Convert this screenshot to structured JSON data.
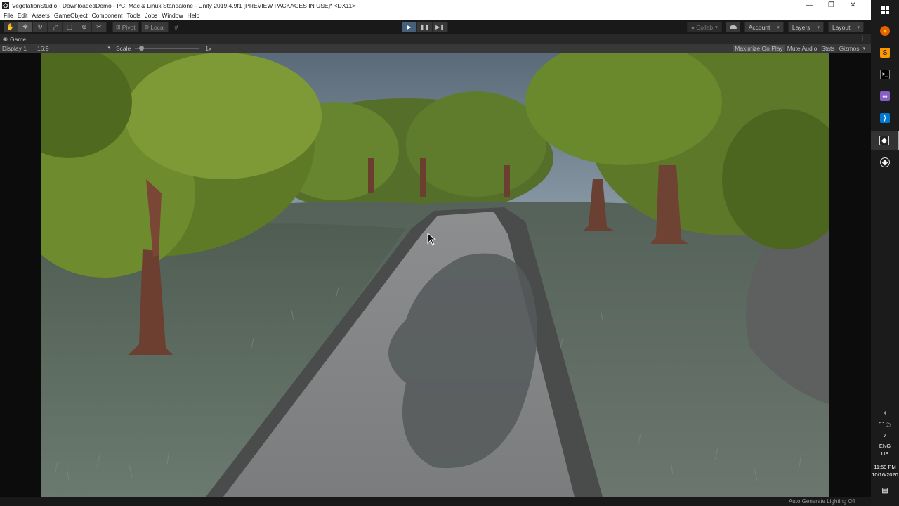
{
  "window": {
    "title": "VegetationStudio - DownloadedDemo - PC, Mac & Linux Standalone - Unity 2019.4.9f1 [PREVIEW PACKAGES IN USE]* <DX11>",
    "controls": [
      "—",
      "❐",
      "✕"
    ]
  },
  "menu": [
    "File",
    "Edit",
    "Assets",
    "GameObject",
    "Component",
    "Tools",
    "Jobs",
    "Window",
    "Help"
  ],
  "toolbar": {
    "tools": [
      {
        "name": "hand-tool",
        "glyph": "✋"
      },
      {
        "name": "move-tool",
        "glyph": "✥"
      },
      {
        "name": "rotate-tool",
        "glyph": "↻"
      },
      {
        "name": "scale-tool",
        "glyph": "⤢"
      },
      {
        "name": "rect-tool",
        "glyph": "▢"
      },
      {
        "name": "transform-tool",
        "glyph": "⊕"
      },
      {
        "name": "custom-tool",
        "glyph": "✂"
      }
    ],
    "active_tool": "move-tool",
    "pivot_label": "Pivot",
    "local_label": "Local",
    "collab_label": "Collab",
    "account_label": "Account",
    "layers_label": "Layers",
    "layout_label": "Layout"
  },
  "playback": {
    "play": "▶",
    "pause": "❚❚",
    "step": "▶❚",
    "playing": true
  },
  "game": {
    "tab_label": "Game",
    "display": "Display 1",
    "aspect": "16:9",
    "scale_label": "Scale",
    "scale_value": "1x",
    "options": [
      "Maximize On Play",
      "Mute Audio",
      "Stats",
      "Gizmos"
    ],
    "maximize_on_play_active": true
  },
  "status": {
    "message": "Auto Generate Lighting Off"
  },
  "taskbar": {
    "apps": [
      "start",
      "firefox",
      "sublime-text",
      "terminal",
      "visual-studio",
      "vscode",
      "unity",
      "unity-hub"
    ],
    "selected": "unity",
    "lang": "ENG",
    "region": "US",
    "time": "11:59 PM",
    "date": "10/16/2020"
  },
  "colors": {
    "accent": "#46607c",
    "editor_bg": "#191919",
    "sky": "#6f8294",
    "grass": "#5d6d63",
    "road": "#7b7d7e",
    "foliage": "#5f7a26"
  }
}
